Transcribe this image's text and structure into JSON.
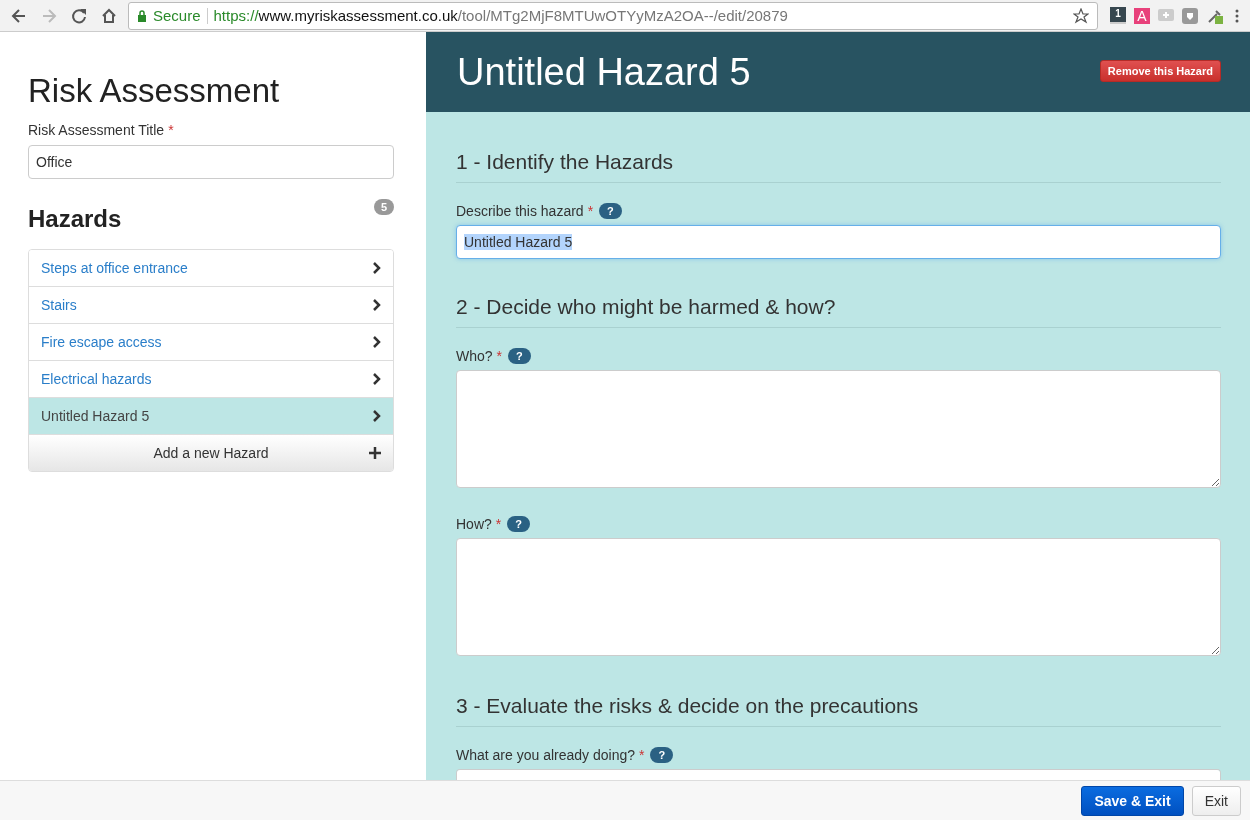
{
  "browser": {
    "secure_label": "Secure",
    "url_scheme": "https://",
    "url_host": "www.myriskassessment.co.uk",
    "url_path": "/tool/MTg2MjF8MTUwOTYyMzA2OA--/edit/20879",
    "extensions": [
      {
        "kind": "badge",
        "label": "1"
      },
      {
        "kind": "letter",
        "label": "A"
      },
      {
        "kind": "plus"
      },
      {
        "kind": "shield"
      },
      {
        "kind": "dropper"
      }
    ]
  },
  "sidebar": {
    "heading": "Risk Assessment",
    "title_label": "Risk Assessment Title",
    "title_required_mark": "*",
    "title_value": "Office",
    "hazards_heading": "Hazards",
    "hazards_count": "5",
    "hazards": [
      {
        "label": "Steps at office entrance",
        "selected": false
      },
      {
        "label": "Stairs",
        "selected": false
      },
      {
        "label": "Fire escape access",
        "selected": false
      },
      {
        "label": "Electrical hazards",
        "selected": false
      },
      {
        "label": "Untitled Hazard 5",
        "selected": true
      }
    ],
    "add_button": "Add a new Hazard"
  },
  "main": {
    "title": "Untitled Hazard 5",
    "remove_button": "Remove this Hazard",
    "sections": [
      {
        "heading": "1 - Identify the Hazards",
        "fields": [
          {
            "label": "Describe this hazard",
            "required_mark": "*",
            "help": "?",
            "kind": "input",
            "value": "Untitled Hazard 5",
            "highlighted": true
          }
        ]
      },
      {
        "heading": "2 - Decide who might be harmed & how?",
        "fields": [
          {
            "label": "Who?",
            "required_mark": "*",
            "help": "?",
            "kind": "textarea"
          },
          {
            "label": "How?",
            "required_mark": "*",
            "help": "?",
            "kind": "textarea"
          }
        ]
      },
      {
        "heading": "3 - Evaluate the risks & decide on the precautions",
        "fields": [
          {
            "label": "What are you already doing?",
            "required_mark": "*",
            "help": "?",
            "kind": "textarea"
          }
        ]
      }
    ]
  },
  "footer": {
    "buttons": [
      {
        "label": "Save & Exit",
        "kind": "primary"
      },
      {
        "label": "Exit",
        "kind": "default"
      }
    ]
  }
}
